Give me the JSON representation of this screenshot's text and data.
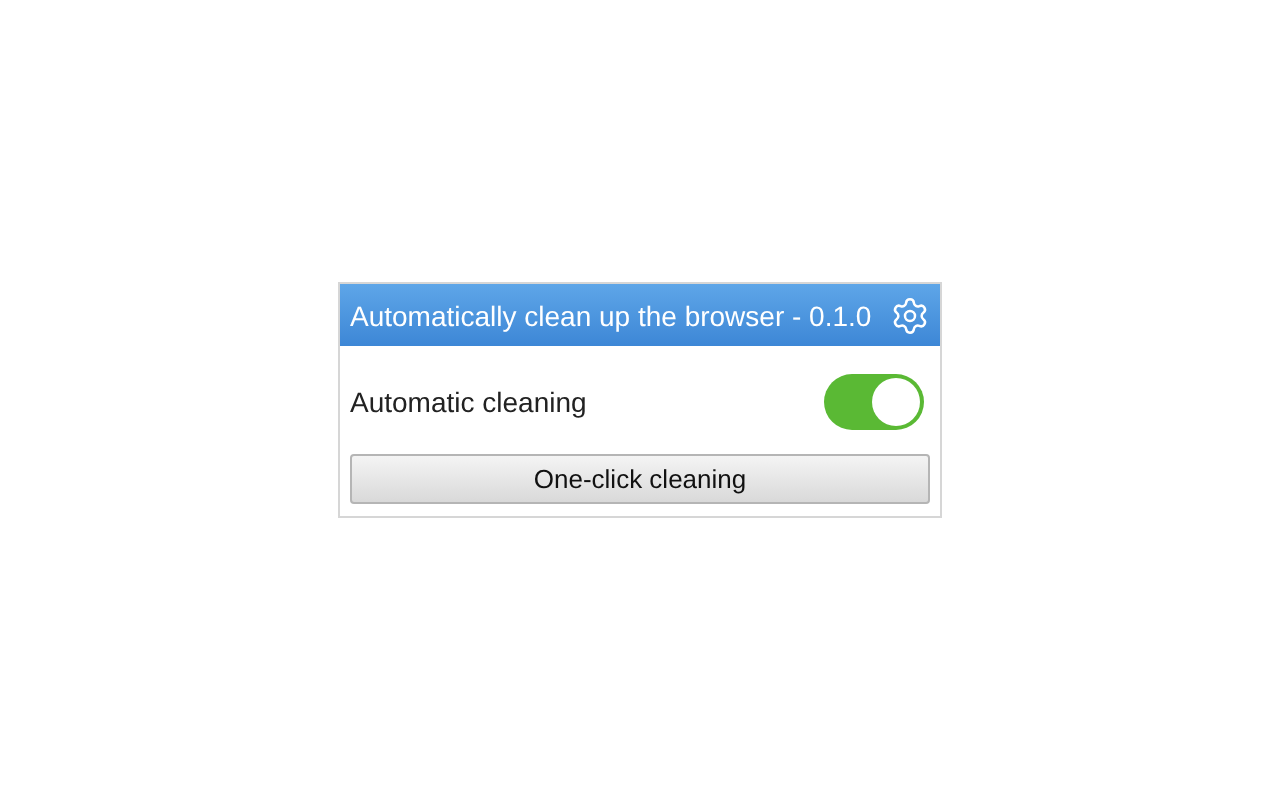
{
  "header": {
    "title": "Automatically clean up the browser - 0.1.0"
  },
  "setting": {
    "label": "Automatic cleaning",
    "on": true
  },
  "button": {
    "label": "One-click cleaning"
  }
}
